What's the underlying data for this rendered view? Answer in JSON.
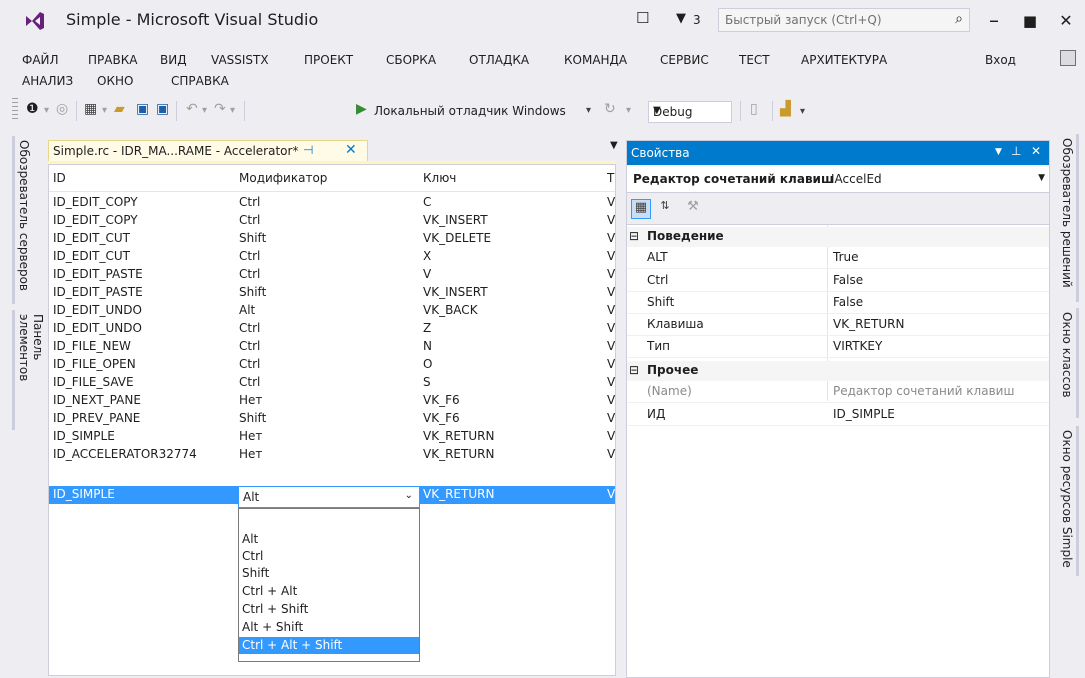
{
  "window": {
    "title": "Simple - Microsoft Visual Studio",
    "notification_count": "3",
    "quick_launch_placeholder": "Быстрый запуск (Ctrl+Q)",
    "sign_in": "Вход"
  },
  "menu": {
    "items": [
      "ФАЙЛ",
      "ПРАВКА",
      "ВИД",
      "VASSISTX",
      "ПРОЕКТ",
      "СБОРКА",
      "ОТЛАДКА",
      "КОМАНДА",
      "СЕРВИС",
      "ТЕСТ",
      "АРХИТЕКТУРА",
      "АНАЛИЗ",
      "ОКНО",
      "СПРАВКА"
    ]
  },
  "toolbar": {
    "debugger_label": "Локальный отладчик Windows",
    "configuration": "Debug"
  },
  "side_left": {
    "tabs": [
      "Обозреватель серверов",
      "Панель элементов"
    ]
  },
  "side_right": {
    "tabs": [
      "Обозреватель решений",
      "Окно классов",
      "Окно ресурсов Simple"
    ]
  },
  "document": {
    "tab_title": "Simple.rc - IDR_MA...RAME - Accelerator*",
    "columns": [
      "ID",
      "Модификатор",
      "Ключ",
      "T"
    ],
    "rows": [
      {
        "id": "ID_EDIT_COPY",
        "modifier": "Ctrl",
        "key": "C",
        "type": "V"
      },
      {
        "id": "ID_EDIT_COPY",
        "modifier": "Ctrl",
        "key": "VK_INSERT",
        "type": "V"
      },
      {
        "id": "ID_EDIT_CUT",
        "modifier": "Shift",
        "key": "VK_DELETE",
        "type": "V"
      },
      {
        "id": "ID_EDIT_CUT",
        "modifier": "Ctrl",
        "key": "X",
        "type": "V"
      },
      {
        "id": "ID_EDIT_PASTE",
        "modifier": "Ctrl",
        "key": "V",
        "type": "V"
      },
      {
        "id": "ID_EDIT_PASTE",
        "modifier": "Shift",
        "key": "VK_INSERT",
        "type": "V"
      },
      {
        "id": "ID_EDIT_UNDO",
        "modifier": "Alt",
        "key": "VK_BACK",
        "type": "V"
      },
      {
        "id": "ID_EDIT_UNDO",
        "modifier": "Ctrl",
        "key": "Z",
        "type": "V"
      },
      {
        "id": "ID_FILE_NEW",
        "modifier": "Ctrl",
        "key": "N",
        "type": "V"
      },
      {
        "id": "ID_FILE_OPEN",
        "modifier": "Ctrl",
        "key": "O",
        "type": "V"
      },
      {
        "id": "ID_FILE_SAVE",
        "modifier": "Ctrl",
        "key": "S",
        "type": "V"
      },
      {
        "id": "ID_NEXT_PANE",
        "modifier": "Нет",
        "key": "VK_F6",
        "type": "V"
      },
      {
        "id": "ID_PREV_PANE",
        "modifier": "Shift",
        "key": "VK_F6",
        "type": "V"
      },
      {
        "id": "ID_SIMPLE",
        "modifier": "Нет",
        "key": "VK_RETURN",
        "type": "V"
      },
      {
        "id": "ID_ACCELERATOR32774",
        "modifier": "Нет",
        "key": "VK_RETURN",
        "type": "V"
      },
      {
        "id": "ID_SIMPLE",
        "modifier": "",
        "key": "VK_RETURN",
        "type": "V"
      }
    ],
    "editor": {
      "current_value": "Alt",
      "options": [
        "",
        "Alt",
        "Ctrl",
        "Shift",
        "Ctrl + Alt",
        "Ctrl + Shift",
        "Alt + Shift",
        "Ctrl + Alt + Shift"
      ],
      "highlighted_option": "Ctrl + Alt + Shift"
    }
  },
  "properties": {
    "title": "Свойства",
    "object_name": "Редактор сочетаний клавиш",
    "object_type": "IAccelEd",
    "categories": [
      {
        "name": "Поведение",
        "toggle": "⊟",
        "props": [
          {
            "name": "ALT",
            "value": "True"
          },
          {
            "name": "Ctrl",
            "value": "False"
          },
          {
            "name": "Shift",
            "value": "False"
          },
          {
            "name": "Клавиша",
            "value": "VK_RETURN"
          },
          {
            "name": "Тип",
            "value": "VIRTKEY"
          }
        ]
      },
      {
        "name": "Прочее",
        "toggle": "⊟",
        "props": [
          {
            "name": "(Name)",
            "value": "Редактор сочетаний клавиш"
          },
          {
            "name": "ИД",
            "value": "ID_SIMPLE"
          }
        ]
      }
    ]
  },
  "colors": {
    "accent": "#007acc",
    "selection": "#3399ff",
    "tab_active": "#fffbe6",
    "vs_purple": "#68217a"
  }
}
